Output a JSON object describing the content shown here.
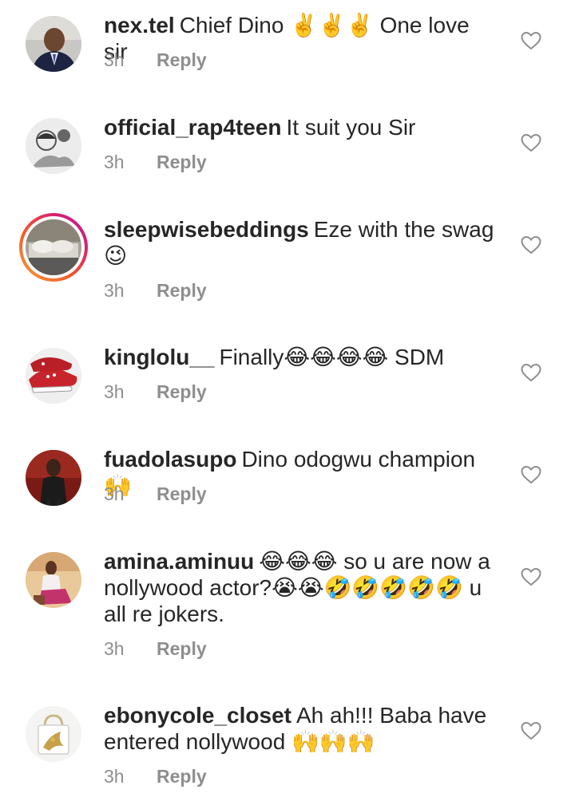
{
  "comments": [
    {
      "username": "nex.tel",
      "text": "Chief Dino ✌️✌️✌️ One love sir",
      "time": "3h",
      "reply_label": "Reply",
      "avatar_icon": "profile-photo-man-in-suit",
      "story_ring": false
    },
    {
      "username": "official_rap4teen",
      "text": "It suit you Sir",
      "time": "3h",
      "reply_label": "Reply",
      "avatar_icon": "profile-photo-sketch",
      "story_ring": false
    },
    {
      "username": "sleepwisebeddings",
      "text": "Eze with the swag 😉",
      "time": "3h",
      "reply_label": "Reply",
      "avatar_icon": "profile-photo-bed-pillows",
      "story_ring": true
    },
    {
      "username": "kinglolu__",
      "text": "Finally😂😂😂😂 SDM",
      "time": "3h",
      "reply_label": "Reply",
      "avatar_icon": "profile-photo-red-sneakers",
      "story_ring": false
    },
    {
      "username": "fuadolasupo",
      "text": "Dino odogwu champion🙌",
      "time": "3h",
      "reply_label": "Reply",
      "avatar_icon": "profile-photo-man-dark",
      "story_ring": false
    },
    {
      "username": "amina.aminuu",
      "text": "😂😂😂 so u are now a nollywood actor?😭😭🤣🤣🤣🤣🤣 u all re jokers.",
      "time": "3h",
      "reply_label": "Reply",
      "avatar_icon": "profile-photo-woman-seated",
      "story_ring": false
    },
    {
      "username": "ebonycole_closet",
      "text": "Ah ah!!! Baba have entered nollywood 🙌🙌🙌",
      "time": "3h",
      "reply_label": "Reply",
      "avatar_icon": "profile-photo-handbag",
      "story_ring": false
    }
  ],
  "icons": {
    "like": "heart-outline-icon"
  },
  "colors": {
    "text": "#262626",
    "muted": "#8e8e8e",
    "heart_stroke": "#8e8e8e",
    "story_ring_start": "#f9a23a",
    "story_ring_end": "#b41a9a"
  }
}
